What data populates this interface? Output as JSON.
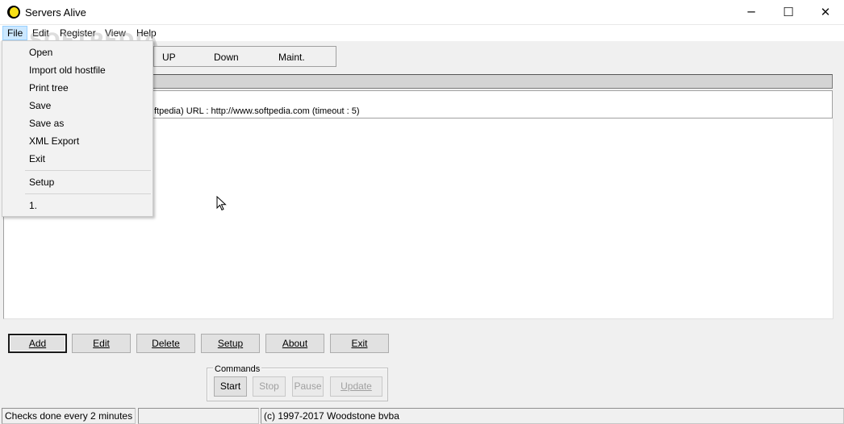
{
  "window": {
    "title": "Servers Alive",
    "minimize_glyph": "─",
    "maximize_glyph": "☐",
    "close_glyph": "✕"
  },
  "menubar": {
    "items": [
      {
        "label": "File"
      },
      {
        "label": "Edit"
      },
      {
        "label": "Register"
      },
      {
        "label": "View"
      },
      {
        "label": "Help"
      }
    ]
  },
  "legend": {
    "up": "UP",
    "down": "Down",
    "maint": "Maint."
  },
  "tree": {
    "entry_text": "ftpedia) URL : http://www.softpedia.com  (timeout :  5)"
  },
  "buttons": {
    "add": "Add",
    "edit": "Edit",
    "delete": "Delete",
    "setup": "Setup",
    "about": "About",
    "exit": "Exit"
  },
  "commands": {
    "caption": "Commands",
    "start": "Start",
    "stop": "Stop",
    "pause": "Pause",
    "update": "Update"
  },
  "status": {
    "checks": "Checks done every  2 minutes",
    "middle": "",
    "copyright": "(c) 1997-2017 Woodstone bvba"
  },
  "file_menu": {
    "items": [
      "Open",
      "Import old hostfile",
      "Print tree",
      "Save",
      "Save as",
      "XML Export",
      "Exit"
    ],
    "setup": "Setup",
    "recent": "1."
  },
  "watermark": "SOFTPEDIA",
  "colors": {
    "menu_highlight": "#cce8ff",
    "app_icon_yellow": "#f7e017"
  },
  "icons": {
    "app": "moon-icon",
    "pointer": "mouse-pointer-icon"
  }
}
